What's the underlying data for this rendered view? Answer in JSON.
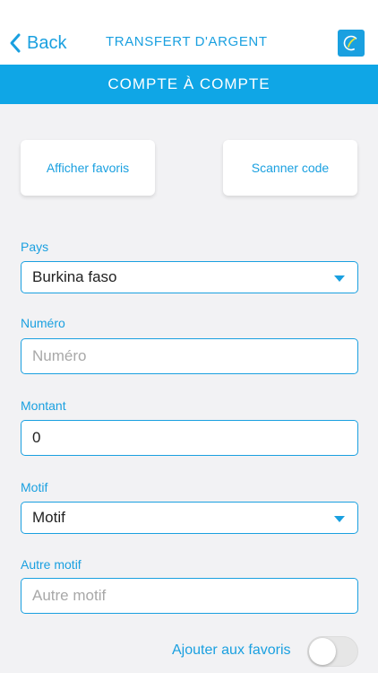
{
  "nav": {
    "back_label": "Back",
    "title": "TRANSFERT D'ARGENT"
  },
  "banner": {
    "title": "COMPTE À COMPTE"
  },
  "actions": {
    "favorites_label": "Afficher favoris",
    "scan_label": "Scanner code"
  },
  "form": {
    "pays": {
      "label": "Pays",
      "value": "Burkina faso"
    },
    "numero": {
      "label": "Numéro",
      "placeholder": "Numéro",
      "value": ""
    },
    "montant": {
      "label": "Montant",
      "value": "0"
    },
    "motif": {
      "label": "Motif",
      "value": "Motif"
    },
    "autre_motif": {
      "label": "Autre motif",
      "placeholder": "Autre motif",
      "value": ""
    }
  },
  "favorite_toggle": {
    "label": "Ajouter aux favoris",
    "checked": false
  },
  "colors": {
    "accent": "#1aa0e0",
    "banner": "#0fa6e6",
    "background": "#f2f2f4"
  },
  "icons": {
    "back": "chevron-left-icon",
    "logo": "app-logo-icon",
    "dropdown": "caret-down-icon"
  }
}
